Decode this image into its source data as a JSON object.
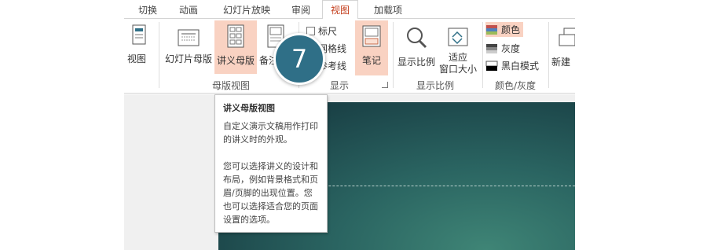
{
  "tabs": [
    "切换",
    "动画",
    "幻灯片放映",
    "审阅",
    "视图",
    "加载项"
  ],
  "active_tab_index": 4,
  "ribbon": {
    "views": {
      "partial_view_label": "视图",
      "slide_master": "幻灯片母版",
      "handout_master": "讲义母版",
      "notes_master_partial": "备注",
      "group_label": "母版视图"
    },
    "show": {
      "ruler": "标尺",
      "gridlines": "网格线",
      "guides_partial": "参考线",
      "notes": "笔记",
      "group_label": "显示"
    },
    "zoom": {
      "zoom": "显示比例",
      "fit_line1": "适应",
      "fit_line2": "窗口大小",
      "group_label": "显示比例"
    },
    "color": {
      "color": "颜色",
      "grayscale": "灰度",
      "black_white": "黑白模式",
      "group_label": "颜色/灰度"
    },
    "window": {
      "new_window_partial": "新建"
    }
  },
  "tooltip": {
    "title": "讲义母版视图",
    "para1": "自定义演示文稿用作打印的讲义时的外观。",
    "para2": "您可以选择讲义的设计和布局，例如背景格式和页眉/页脚的出现位置。您也可以选择适合您的页面设置的选项。"
  },
  "step_badge": "7",
  "colors": {
    "accent_tab": "#c43e1c",
    "hover": "#f9d2c2",
    "badge": "#2f6f87",
    "slide_dark": "#1a4146",
    "slide_light": "#3f8576"
  }
}
